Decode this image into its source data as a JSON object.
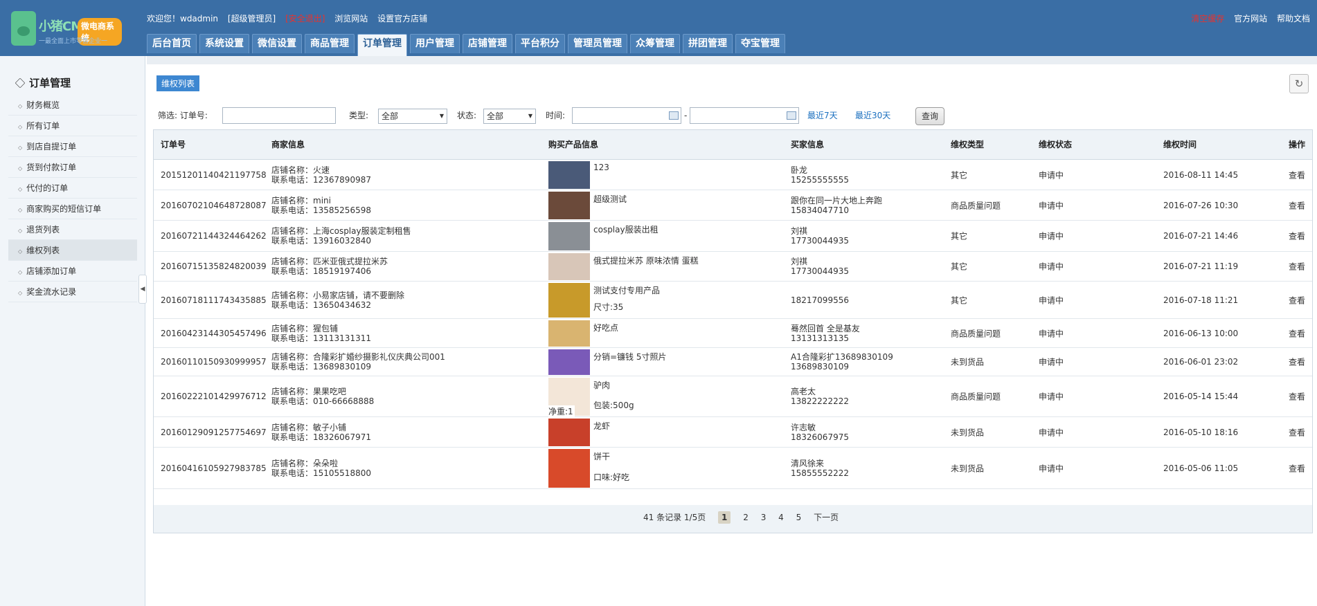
{
  "header": {
    "logo_text": "小猪CMS",
    "logo_badge": "微电商系统",
    "logo_sub": "一最全面上市零售企业一",
    "welcome": "欢迎您！wdadmin",
    "role": "[超级管理员]",
    "logout": "[安全退出]",
    "browse": "浏览网站",
    "set_store": "设置官方店铺",
    "clear_cache": "清空缓存",
    "official_site": "官方网站",
    "help": "帮助文档"
  },
  "nav": [
    "后台首页",
    "系统设置",
    "微信设置",
    "商品管理",
    "订单管理",
    "用户管理",
    "店铺管理",
    "平台积分",
    "管理员管理",
    "众筹管理",
    "拼团管理",
    "夺宝管理"
  ],
  "sidebar": {
    "title": "订单管理",
    "items": [
      "财务概览",
      "所有订单",
      "到店自提订单",
      "货到付款订单",
      "代付的订单",
      "商家购买的短信订单",
      "退货列表",
      "维权列表",
      "店铺添加订单",
      "奖金流水记录"
    ],
    "active": "维权列表"
  },
  "main": {
    "tag": "维权列表",
    "refresh_icon": "refresh-icon",
    "filter": {
      "label": "筛选: 订单号:",
      "order_no": "",
      "type_label": "类型:",
      "type_value": "全部",
      "status_label": "状态:",
      "status_value": "全部",
      "time_label": "时间:",
      "date_from": "",
      "dash": "-",
      "date_to": "",
      "recent7": "最近7天",
      "recent30": "最近30天",
      "query": "查询"
    },
    "columns": [
      "订单号",
      "商家信息",
      "购买产品信息",
      "买家信息",
      "维权类型",
      "维权状态",
      "维权时间",
      "操作"
    ],
    "rows": [
      {
        "order": "20151201140421197758",
        "shop": "店铺名称：火速",
        "phone": "联系电话：12367890987",
        "product": "123",
        "spec": "",
        "buyer": "卧龙",
        "buyer_phone": "15255555555",
        "type": "其它",
        "status": "申请中",
        "time": "2016-08-11 14:45",
        "op": "查看"
      },
      {
        "order": "20160702104648728087",
        "shop": "店铺名称：mini",
        "phone": "联系电话：13585256598",
        "product": "超级测试",
        "spec": "",
        "buyer": "跟你在同一片大地上奔跑",
        "buyer_phone": "15834047710",
        "type": "商品质量问题",
        "status": "申请中",
        "time": "2016-07-26 10:30",
        "op": "查看"
      },
      {
        "order": "20160721144324464262",
        "shop": "店铺名称：上海cosplay服装定制租售",
        "phone": "联系电话：13916032840",
        "product": "cosplay服装出租",
        "spec": "",
        "buyer": "刘祺",
        "buyer_phone": "17730044935",
        "type": "其它",
        "status": "申请中",
        "time": "2016-07-21 14:46",
        "op": "查看"
      },
      {
        "order": "20160715135824820039",
        "shop": "店铺名称：匹米亚俄式提拉米苏",
        "phone": "联系电话：18519197406",
        "product": "俄式提拉米苏 原味浓情 蛋糕",
        "spec": "",
        "buyer": "刘祺",
        "buyer_phone": "17730044935",
        "type": "其它",
        "status": "申请中",
        "time": "2016-07-21 11:19",
        "op": "查看"
      },
      {
        "order": "20160718111743435885",
        "shop": "店铺名称：小易家店铺，请不要删除",
        "phone": "联系电话：13650434632",
        "product": "测试支付专用产品",
        "spec": "尺寸:35",
        "buyer": "",
        "buyer_phone": "18217099556",
        "type": "其它",
        "status": "申请中",
        "time": "2016-07-18 11:21",
        "op": "查看"
      },
      {
        "order": "20160423144305457496",
        "shop": "店铺名称：猩包铺",
        "phone": "联系电话：13113131311",
        "product": "好吃点",
        "spec": "",
        "buyer": "蓦然回首 全是基友",
        "buyer_phone": "13131313135",
        "type": "商品质量问题",
        "status": "申请中",
        "time": "2016-06-13 10:00",
        "op": "查看"
      },
      {
        "order": "20160110150930999957",
        "shop": "店铺名称：合隆彩扩婚纱摄影礼仪庆典公司001",
        "phone": "联系电话：13689830109",
        "product": "分销=镰钱 5寸照片",
        "spec": "",
        "buyer": "A1合隆彩扩13689830109",
        "buyer_phone": "13689830109",
        "type": "未到货品",
        "status": "申请中",
        "time": "2016-06-01 23:02",
        "op": "查看"
      },
      {
        "order": "20160222101429976712",
        "shop": "店铺名称：果果吃吧",
        "phone": "联系电话：010-66668888",
        "product": "驴肉",
        "spec": "包装:500g",
        "extra": "净重:1",
        "buyer": "高老太",
        "buyer_phone": "13822222222",
        "type": "商品质量问题",
        "status": "申请中",
        "time": "2016-05-14 15:44",
        "op": "查看"
      },
      {
        "order": "20160129091257754697",
        "shop": "店铺名称：敏子小铺",
        "phone": "联系电话：18326067971",
        "product": "龙虾",
        "spec": "",
        "buyer": "许志敏",
        "buyer_phone": "18326067975",
        "type": "未到货品",
        "status": "申请中",
        "time": "2016-05-10 18:16",
        "op": "查看"
      },
      {
        "order": "20160416105927983785",
        "shop": "店铺名称：朵朵啦",
        "phone": "联系电话：15105518800",
        "product": "饼干",
        "spec": "口味:好吃",
        "buyer": "清风徐来",
        "buyer_phone": "15855552222",
        "type": "未到货品",
        "status": "申请中",
        "time": "2016-05-06 11:05",
        "op": "查看"
      }
    ],
    "pager": {
      "summary": "41 条记录 1/5页",
      "pages": [
        "1",
        "2",
        "3",
        "4",
        "5"
      ],
      "current": "1",
      "next": "下一页"
    }
  },
  "colors": {
    "header_bg": "#3a6ea5",
    "accent": "#3d87d1",
    "sidebar_bg": "#f1f5f9"
  }
}
